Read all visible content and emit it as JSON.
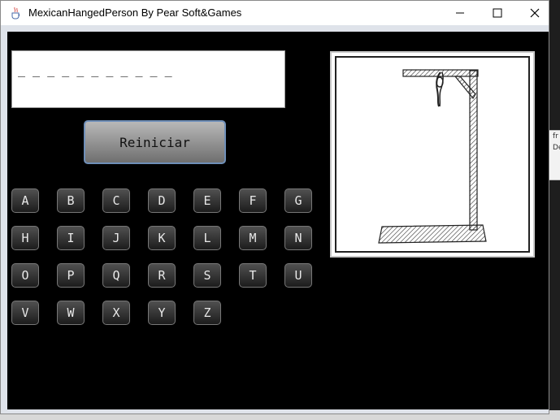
{
  "window": {
    "title": "MexicanHangedPerson By Pear Soft&Games",
    "icons": {
      "app": "java-cup-icon",
      "minimize": "minimize-icon",
      "maximize": "maximize-icon",
      "close": "close-icon"
    }
  },
  "game": {
    "word_display": "_ _ _ _ _ _ _ _ _ _ _",
    "restart_label": "Reiniciar",
    "letters": [
      [
        "A",
        "B",
        "C",
        "D",
        "E",
        "F",
        "G"
      ],
      [
        "H",
        "I",
        "J",
        "K",
        "L",
        "M",
        "N"
      ],
      [
        "O",
        "P",
        "Q",
        "R",
        "S",
        "T",
        "U"
      ],
      [
        "V",
        "W",
        "X",
        "Y",
        "Z"
      ]
    ],
    "hangman_stage_icon": "empty-gallows-drawing"
  },
  "desktop": {
    "strip_lines": [
      "fr",
      "De"
    ]
  }
}
